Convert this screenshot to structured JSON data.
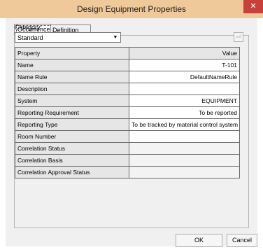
{
  "window": {
    "title": "Design Equipment Properties",
    "close_glyph": "✕"
  },
  "tabs": [
    {
      "label": "Occurrence",
      "active": true
    },
    {
      "label": "Definition",
      "active": false
    }
  ],
  "category": {
    "label": "Category:",
    "value": "Standard"
  },
  "table": {
    "header": {
      "property": "Property",
      "value": "Value"
    },
    "rows": [
      {
        "property": "Name",
        "value": "T-101"
      },
      {
        "property": "Name Rule",
        "value": "DefaultNameRule"
      },
      {
        "property": "Description",
        "value": ""
      },
      {
        "property": "System",
        "value": "EQUIPMENT"
      },
      {
        "property": "Reporting Requirement",
        "value": "To be reported"
      },
      {
        "property": "Reporting Type",
        "value": "To be tracked by material control system"
      },
      {
        "property": "Room Number",
        "value": ""
      },
      {
        "property": "Correlation Status",
        "value": ""
      },
      {
        "property": "Correlation Basis",
        "value": ""
      },
      {
        "property": "Correlation Approval Status",
        "value": ""
      }
    ]
  },
  "buttons": {
    "ok": "OK",
    "cancel": "Cancel"
  }
}
